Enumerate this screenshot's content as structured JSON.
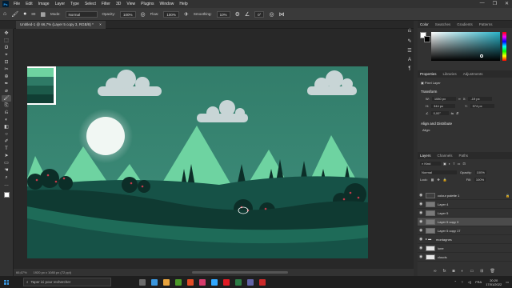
{
  "app": {
    "logo": "Ps"
  },
  "menu": [
    "File",
    "Edit",
    "Image",
    "Layer",
    "Type",
    "Select",
    "Filter",
    "3D",
    "View",
    "Plugins",
    "Window",
    "Help"
  ],
  "window_controls": [
    "—",
    "❐",
    "✕"
  ],
  "options": {
    "brush_size": "80",
    "mode_label": "Mode:",
    "mode_value": "Normal",
    "opacity_label": "Opacity:",
    "opacity_value": "100%",
    "flow_label": "Flow:",
    "flow_value": "100%",
    "smoothing_label": "Smoothing:",
    "smoothing_value": "10%",
    "angle_value": "0°"
  },
  "document_tab": "Untitled-1 @ 66,7% (Layer 5 copy 3, RGB/8) *",
  "status": {
    "zoom": "66,67%",
    "doc_info": "1920 px x 1080 px (72 ppi)"
  },
  "tools": [
    "✥",
    "⬚",
    "ʘ",
    "⌖",
    "⊡",
    "✂",
    "⊕",
    "✒",
    "⌀",
    "🖌",
    "⎘",
    "⎌",
    "◐",
    "◧",
    "○",
    "✐",
    "T",
    "➤",
    "▭",
    "☚",
    "⌕",
    "…"
  ],
  "color_panel": {
    "tabs": [
      "Color",
      "Swatches",
      "Gradients",
      "Patterns"
    ],
    "hue_color": "#2ab3c8",
    "foreground": "#ffffff",
    "background": "#000000"
  },
  "properties_panel": {
    "tabs": [
      "Properties",
      "Libraries",
      "Adjustments"
    ],
    "layer_kind": "Pixel Layer",
    "transform_label": "Transform",
    "w_label": "W:",
    "w_value": "1080 px",
    "x_label": "X:",
    "x_value": "-19 px",
    "h_label": "H:",
    "h_value": "344 px",
    "y_label": "Y:",
    "y_value": "574 px",
    "angle_value": "0,00°",
    "align_label": "Align and Distribute",
    "align_sub": "Align:"
  },
  "layers_panel": {
    "tabs": [
      "Layers",
      "Channels",
      "Paths"
    ],
    "kind_filter": "Kind",
    "blend_mode": "Normal",
    "opacity_label": "Opacity:",
    "opacity_value": "100%",
    "lock_label": "Lock:",
    "fill_label": "Fill:",
    "fill_value": "100%",
    "items": [
      {
        "name": "colour palette 1",
        "thumb": "#3e3e3e",
        "selected": false
      },
      {
        "name": "Layer 4",
        "thumb": "#7a7a7a",
        "selected": false
      },
      {
        "name": "Layer 5",
        "thumb": "#7a7a7a",
        "selected": false
      },
      {
        "name": "Layer 5 copy 3",
        "thumb": "#7a7a7a",
        "selected": true
      },
      {
        "name": "Layer 5 copy 17",
        "thumb": "#7a7a7a",
        "selected": false
      },
      {
        "name": "montagnes",
        "thumb": "folder",
        "selected": false
      },
      {
        "name": "lune",
        "thumb": "#e6e6e6",
        "selected": false
      },
      {
        "name": "clouds",
        "thumb": "#e6e6e6",
        "selected": false
      }
    ]
  },
  "taskbar": {
    "search_placeholder": "Taper ici pour rechercher",
    "icons": [
      "#6b6b6b",
      "#3a96dd",
      "#e8a33d",
      "#4c9a2a",
      "#e44d26",
      "#d63b6b",
      "#31a8ff",
      "#e01b24",
      "#2d7d46",
      "#6264a7",
      "#cc2a2a"
    ],
    "lang": "FRA",
    "time": "20:20",
    "date": "17/01/2022"
  },
  "canvas": {
    "sky_top": "#327d6a",
    "sky_bottom": "#3f8f7c",
    "moon": "#f1f7f3",
    "cloud": "#c8d5d6",
    "mountain": "#6ed3a1",
    "ground_dark": "#0f3a32",
    "ground_mid": "#165247",
    "ground_light": "#1e6b58",
    "tree_dark": "#0c2e28",
    "berries": "#c23a4a",
    "palette": [
      "#6ed3a1",
      "#2e7a66",
      "#1c5a4a",
      "#103e34"
    ]
  }
}
